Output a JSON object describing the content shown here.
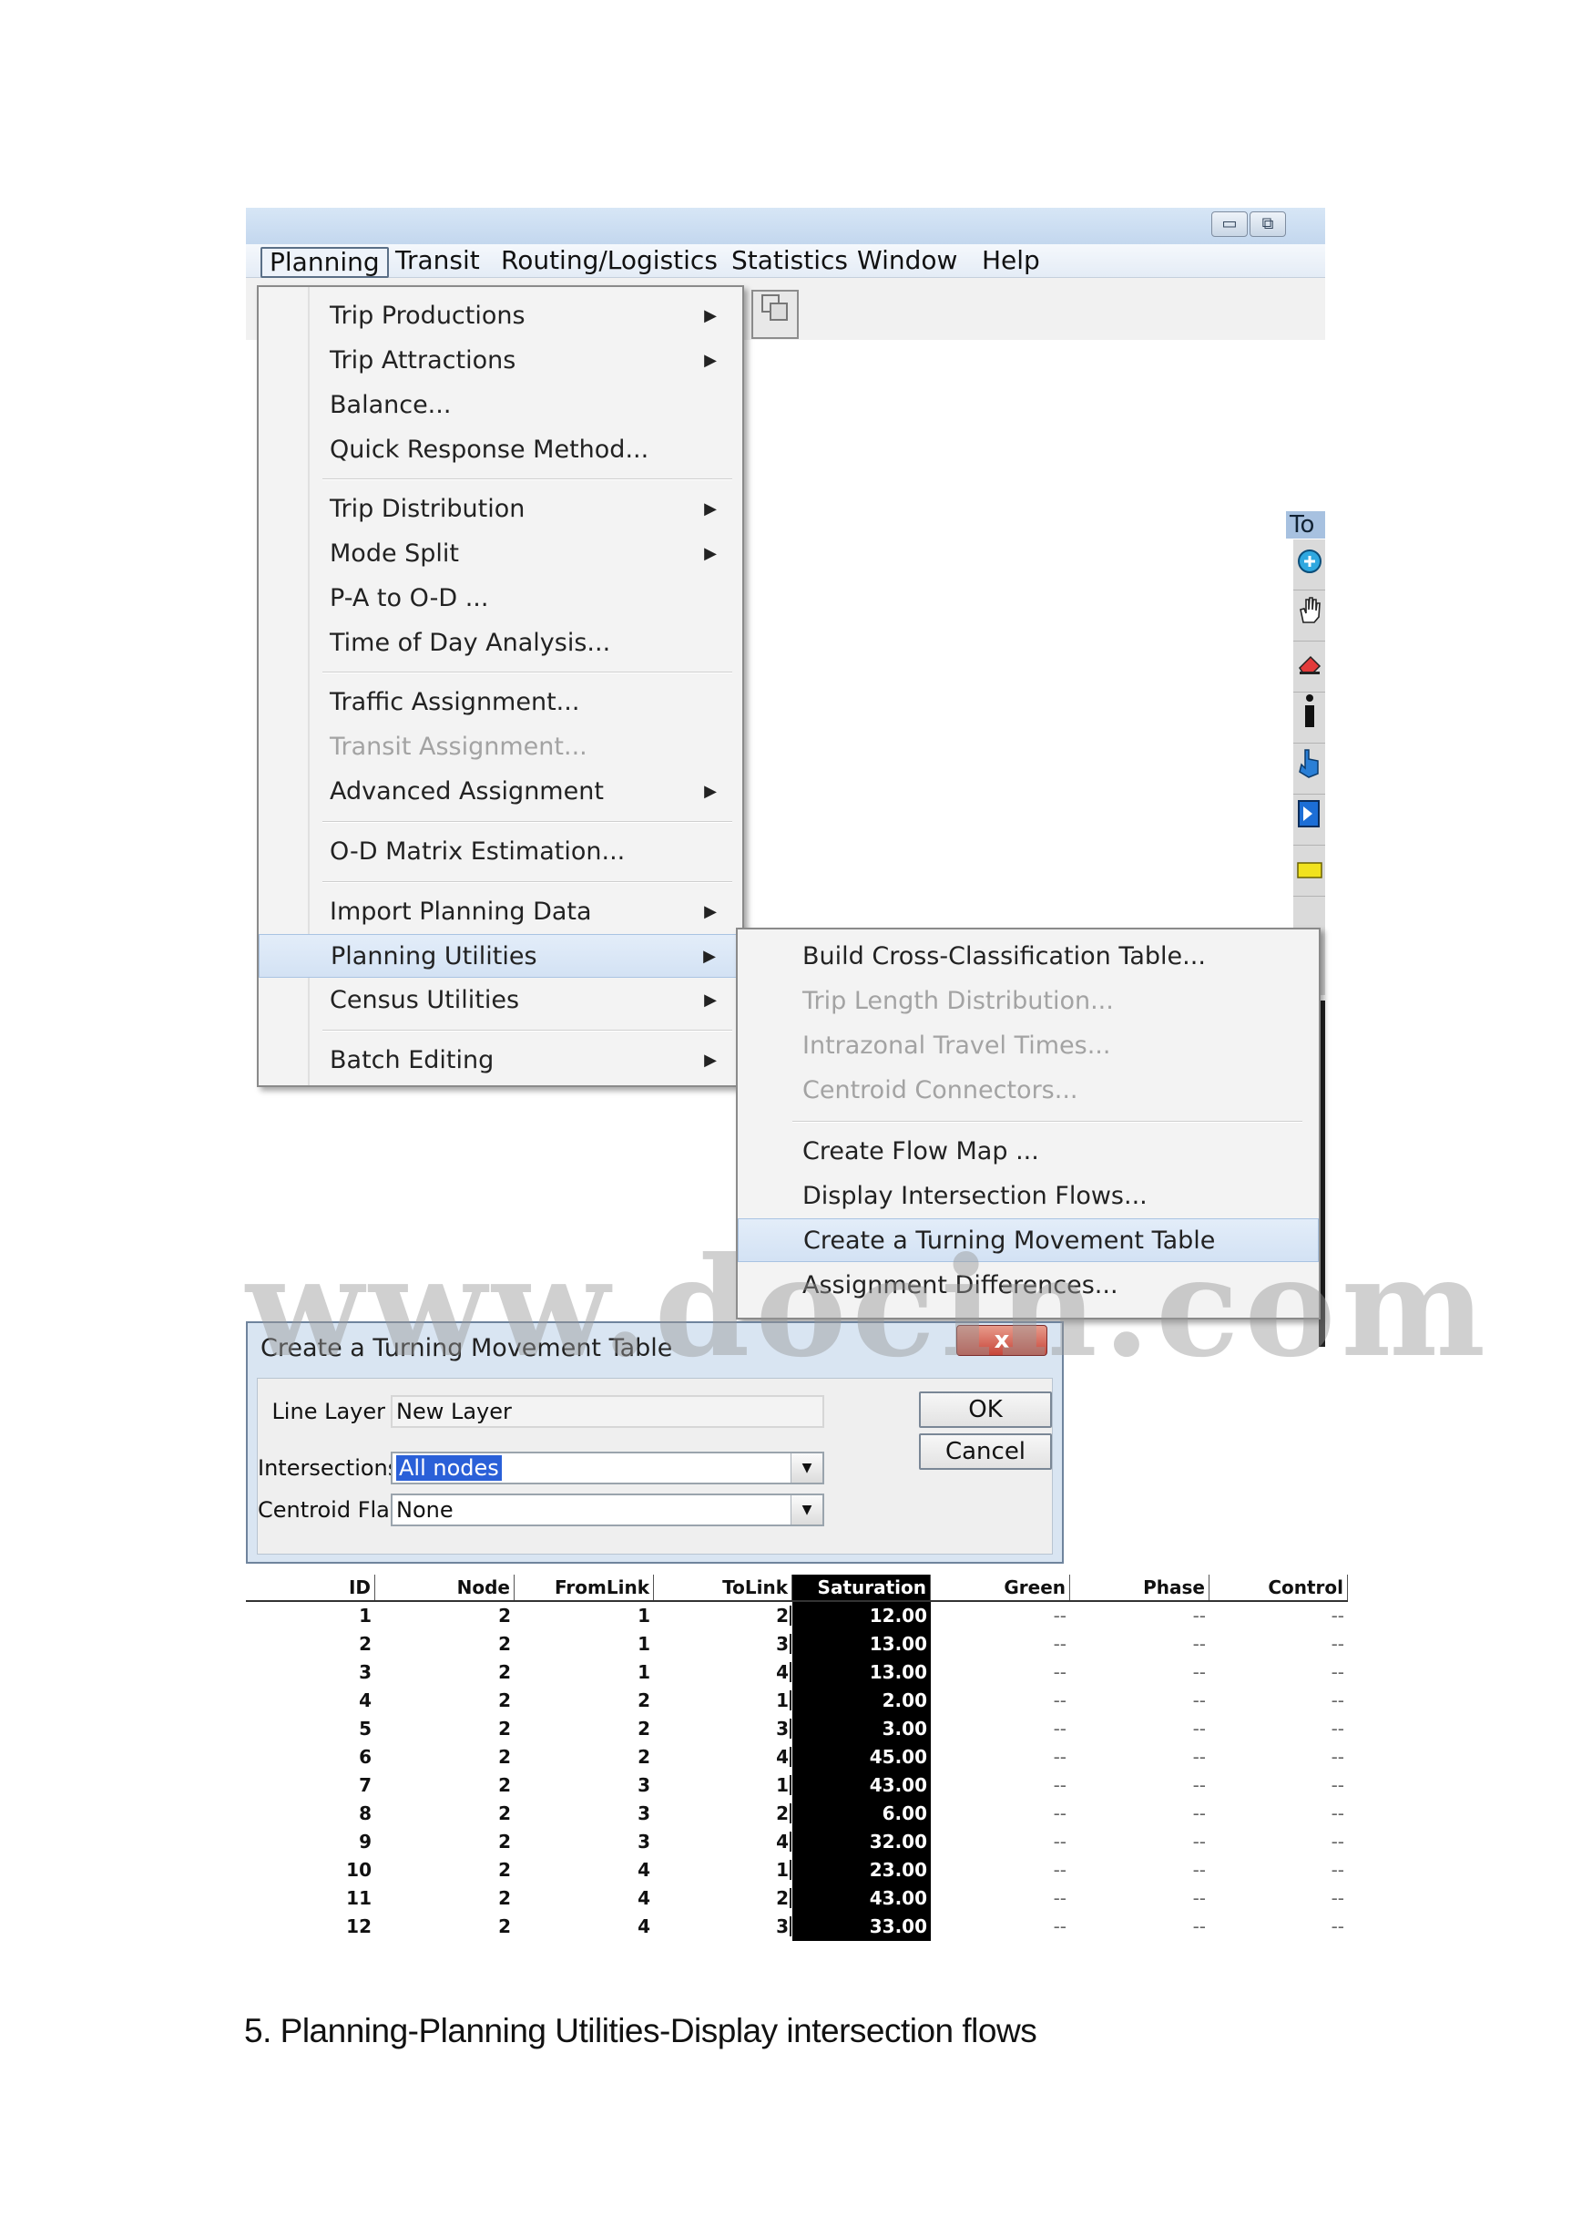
{
  "window": {
    "minimize_glyph": "▭",
    "restore_glyph": "⧉"
  },
  "menubar": {
    "items": [
      "Planning",
      "Transit",
      "Routing/Logistics",
      "Statistics",
      "Window",
      "Help"
    ]
  },
  "toolbox": {
    "title": "To",
    "icons": [
      "zoom-in-icon",
      "hand-pan-icon",
      "eraser-icon",
      "info-icon",
      "pointer-icon",
      "select-icon",
      "label-icon"
    ]
  },
  "planning_menu": {
    "items": [
      {
        "label": "Trip Productions",
        "submenu": true
      },
      {
        "label": "Trip Attractions",
        "submenu": true
      },
      {
        "label": "Balance...",
        "submenu": false
      },
      {
        "label": "Quick Response Method...",
        "submenu": false
      },
      {
        "label": "Trip Distribution",
        "submenu": true
      },
      {
        "label": "Mode Split",
        "submenu": true
      },
      {
        "label": "P-A to O-D ...",
        "submenu": false
      },
      {
        "label": "Time of Day Analysis...",
        "submenu": false
      },
      {
        "label": "Traffic Assignment...",
        "submenu": false
      },
      {
        "label": "Transit Assignment...",
        "submenu": false,
        "disabled": true
      },
      {
        "label": "Advanced Assignment",
        "submenu": true
      },
      {
        "label": "O-D Matrix Estimation...",
        "submenu": false
      },
      {
        "label": "Import Planning Data",
        "submenu": true
      },
      {
        "label": "Planning Utilities",
        "submenu": true,
        "highlighted": true
      },
      {
        "label": "Census Utilities",
        "submenu": true
      },
      {
        "label": "Batch Editing",
        "submenu": true
      }
    ]
  },
  "planning_utilities_submenu": {
    "items": [
      {
        "label": "Build Cross-Classification Table..."
      },
      {
        "label": "Trip Length Distribution...",
        "disabled": true
      },
      {
        "label": "Intrazonal Travel Times...",
        "disabled": true
      },
      {
        "label": "Centroid Connectors...",
        "disabled": true
      },
      {
        "label": "Create Flow Map ..."
      },
      {
        "label": "Display Intersection Flows..."
      },
      {
        "label": "Create a Turning Movement Table",
        "highlighted": true
      },
      {
        "label": "Assignment Differences..."
      }
    ]
  },
  "watermark": "www.docin.com",
  "dialog": {
    "title": "Create a Turning Movement Table",
    "close_glyph": "x",
    "line_layer_label": "Line Layer",
    "line_layer_value": "New Layer",
    "intersections_label": "Intersections",
    "intersections_value": "All nodes",
    "centroid_flag_label": "Centroid Flag",
    "centroid_flag_value": "None",
    "ok_label": "OK",
    "cancel_label": "Cancel"
  },
  "table": {
    "columns": [
      "ID",
      "Node",
      "FromLink",
      "ToLink",
      "Saturation",
      "Green",
      "Phase",
      "Control"
    ],
    "rows": [
      [
        "1",
        "2",
        "1",
        "2",
        "12.00",
        "--",
        "--",
        "--"
      ],
      [
        "2",
        "2",
        "1",
        "3",
        "13.00",
        "--",
        "--",
        "--"
      ],
      [
        "3",
        "2",
        "1",
        "4",
        "13.00",
        "--",
        "--",
        "--"
      ],
      [
        "4",
        "2",
        "2",
        "1",
        "2.00",
        "--",
        "--",
        "--"
      ],
      [
        "5",
        "2",
        "2",
        "3",
        "3.00",
        "--",
        "--",
        "--"
      ],
      [
        "6",
        "2",
        "2",
        "4",
        "45.00",
        "--",
        "--",
        "--"
      ],
      [
        "7",
        "2",
        "3",
        "1",
        "43.00",
        "--",
        "--",
        "--"
      ],
      [
        "8",
        "2",
        "3",
        "2",
        "6.00",
        "--",
        "--",
        "--"
      ],
      [
        "9",
        "2",
        "3",
        "4",
        "32.00",
        "--",
        "--",
        "--"
      ],
      [
        "10",
        "2",
        "4",
        "1",
        "23.00",
        "--",
        "--",
        "--"
      ],
      [
        "11",
        "2",
        "4",
        "2",
        "43.00",
        "--",
        "--",
        "--"
      ],
      [
        "12",
        "2",
        "4",
        "3",
        "33.00",
        "--",
        "--",
        "--"
      ]
    ]
  },
  "caption": "5.  Planning-Planning Utilities-Display intersection flows"
}
